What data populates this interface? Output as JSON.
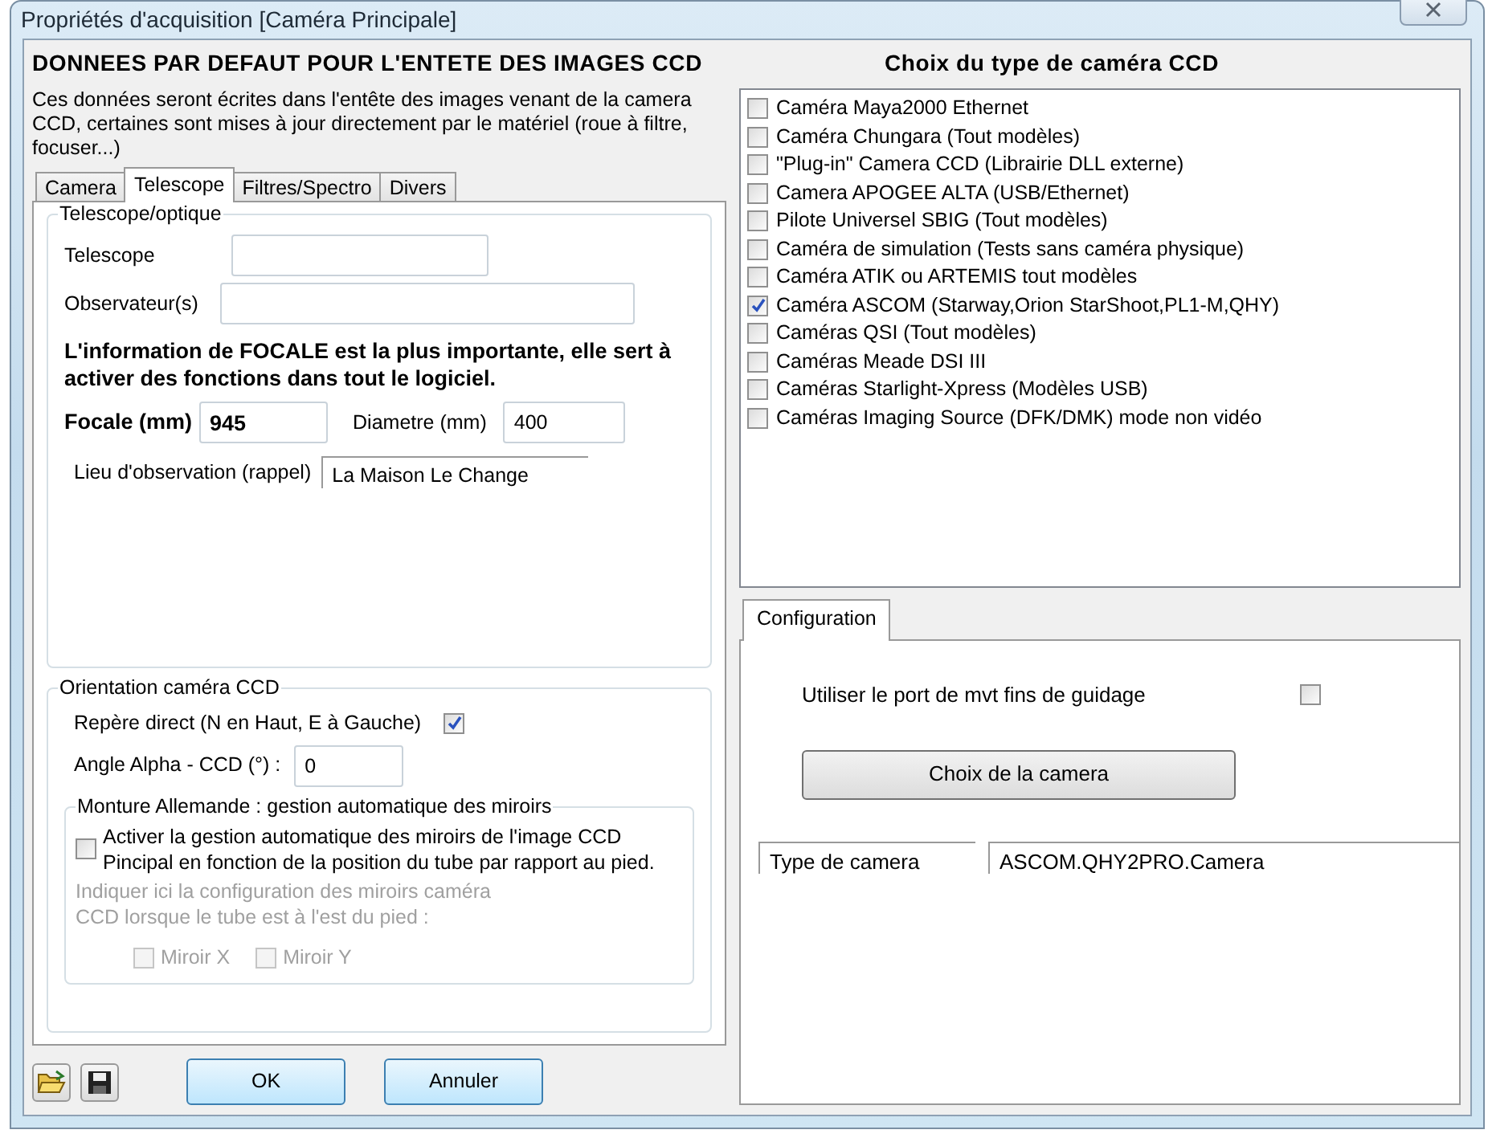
{
  "window": {
    "title": "Propriétés d'acquisition [Caméra Principale]"
  },
  "header": {
    "title": "DONNEES PAR DEFAUT POUR L'ENTETE DES IMAGES CCD",
    "description": "Ces données seront écrites dans l'entête des images  venant de la camera CCD, certaines sont mises à jour directement par le matériel (roue à filtre, focuser...)"
  },
  "tabs": [
    {
      "label": "Camera",
      "selected": false
    },
    {
      "label": "Telescope",
      "selected": true
    },
    {
      "label": "Filtres/Spectro",
      "selected": false
    },
    {
      "label": "Divers",
      "selected": false
    }
  ],
  "telescope_group": {
    "legend": "Telescope/optique",
    "telescope": {
      "label": "Telescope"
    },
    "observers": {
      "label": "Observateur(s)"
    },
    "note": "L'information de FOCALE est la plus importante, elle sert à activer des fonctions dans tout le logiciel.",
    "focal": {
      "label": "Focale (mm)",
      "value": "945"
    },
    "diameter": {
      "label": "Diametre (mm)",
      "value": "400"
    },
    "site": {
      "label": "Lieu d'observation (rappel)",
      "value": "La Maison Le Change"
    }
  },
  "orientation_group": {
    "legend": "Orientation caméra CCD",
    "direct_frame": {
      "label": "Repère direct (N en Haut, E à Gauche)",
      "checked": true
    },
    "angle": {
      "label": "Angle Alpha - CCD (°) :",
      "value": "0"
    },
    "mount_group": {
      "legend": "Monture Allemande : gestion automatique des miroirs",
      "auto_mirror": {
        "label": "Activer la gestion automatique des miroirs de l'image CCD Pincipal en fonction de la position du tube par rapport au pied.",
        "checked": false
      },
      "hint": "Indiquer ici la configuration des miroirs caméra CCD lorsque le tube est à l'est du pied :",
      "disabled": true,
      "mirrors": [
        {
          "label": "Miroir X",
          "checked": false
        },
        {
          "label": "Miroir Y",
          "checked": false
        }
      ]
    }
  },
  "buttons": [
    {
      "label": "OK"
    },
    {
      "label": "Annuler"
    }
  ],
  "camera_types": {
    "title": "Choix du type de caméra CCD",
    "items": [
      {
        "label": "Caméra Maya2000 Ethernet",
        "checked": false
      },
      {
        "label": "Caméra Chungara (Tout modèles)",
        "checked": false
      },
      {
        "label": "\"Plug-in\" Camera CCD (Librairie DLL externe)",
        "checked": false
      },
      {
        "label": "Camera APOGEE ALTA (USB/Ethernet)",
        "checked": false
      },
      {
        "label": "Pilote Universel SBIG (Tout modèles)",
        "checked": false
      },
      {
        "label": "Caméra de simulation (Tests sans caméra physique)",
        "checked": false
      },
      {
        "label": "Caméra ATIK ou ARTEMIS tout modèles",
        "checked": false
      },
      {
        "label": "Caméra ASCOM (Starway,Orion StarShoot,PL1-M,QHY)",
        "checked": true
      },
      {
        "label": "Caméras QSI (Tout modèles)",
        "checked": false
      },
      {
        "label": "Caméras Meade DSI III",
        "checked": false
      },
      {
        "label": "Caméras Starlight-Xpress (Modèles USB)",
        "checked": false
      },
      {
        "label": "Caméras Imaging Source (DFK/DMK) mode non vidéo",
        "checked": false
      }
    ]
  },
  "config": {
    "tabs": [
      {
        "label": "Configuration",
        "selected": true
      }
    ],
    "guiding_port": {
      "label": "Utiliser le port de mvt fins de guidage",
      "checked": false
    },
    "choose_button": "Choix de la camera",
    "camera_type": {
      "label": "Type de camera",
      "value": "ASCOM.QHY2PRO.Camera"
    }
  }
}
